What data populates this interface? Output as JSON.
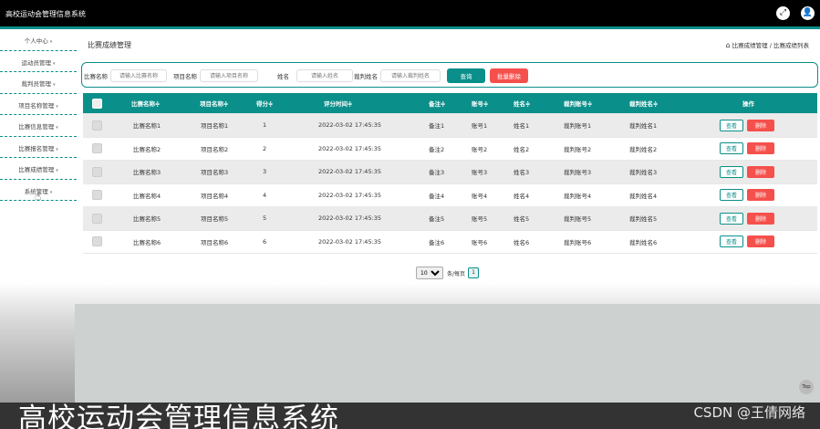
{
  "app": {
    "title": "高校运动会管理信息系统"
  },
  "topbar": {
    "fullscreen_icon": "⤢",
    "user_icon": "👤"
  },
  "sidebar": {
    "items": [
      "个人中心",
      "运动员管理",
      "裁判员管理",
      "项目名称管理",
      "比赛信息管理",
      "比赛报名管理",
      "比赛成绩管理",
      "系统管理"
    ]
  },
  "page": {
    "title": "比赛成绩管理",
    "breadcrumb": "比赛成绩管理 / 比赛成绩列表"
  },
  "search": {
    "fields": [
      {
        "label": "比赛名称",
        "placeholder": "请输入比赛名称"
      },
      {
        "label": "项目名称",
        "placeholder": "请输入项目名称"
      },
      {
        "label": "姓名",
        "placeholder": "请输入姓名"
      },
      {
        "label": "裁判姓名",
        "placeholder": "请输入裁判姓名"
      }
    ],
    "search_label": "查询",
    "batch_delete_label": "批量删除"
  },
  "table": {
    "headers": [
      "比赛名称≑",
      "项目名称≑",
      "得分≑",
      "评分时间≑",
      "备注≑",
      "账号≑",
      "姓名≑",
      "裁判账号≑",
      "裁判姓名≑",
      "操作"
    ],
    "rows": [
      [
        "比赛名称1",
        "项目名称1",
        "1",
        "2022-03-02 17:45:35",
        "备注1",
        "账号1",
        "姓名1",
        "裁判账号1",
        "裁判姓名1"
      ],
      [
        "比赛名称2",
        "项目名称2",
        "2",
        "2022-03-02 17:45:35",
        "备注2",
        "账号2",
        "姓名2",
        "裁判账号2",
        "裁判姓名2"
      ],
      [
        "比赛名称3",
        "项目名称3",
        "3",
        "2022-03-02 17:45:35",
        "备注3",
        "账号3",
        "姓名3",
        "裁判账号3",
        "裁判姓名3"
      ],
      [
        "比赛名称4",
        "项目名称4",
        "4",
        "2022-03-02 17:45:35",
        "备注4",
        "账号4",
        "姓名4",
        "裁判账号4",
        "裁判姓名4"
      ],
      [
        "比赛名称5",
        "项目名称5",
        "5",
        "2022-03-02 17:45:35",
        "备注5",
        "账号5",
        "姓名5",
        "裁判账号5",
        "裁判姓名5"
      ],
      [
        "比赛名称6",
        "项目名称6",
        "6",
        "2022-03-02 17:45:35",
        "备注6",
        "账号6",
        "姓名6",
        "裁判账号6",
        "裁判姓名6"
      ]
    ],
    "view_label": "查看",
    "delete_label": "删除"
  },
  "pager": {
    "page_size": "10",
    "per_page_label": "条/每页",
    "current_page": "1"
  },
  "footer": {
    "overlay_title": "高校运动会管理信息系统",
    "watermark": "CSDN @王倩网络",
    "back_to_top": "Top"
  },
  "colors": {
    "accent": "#0a8f8a",
    "danger": "#f5504c"
  }
}
